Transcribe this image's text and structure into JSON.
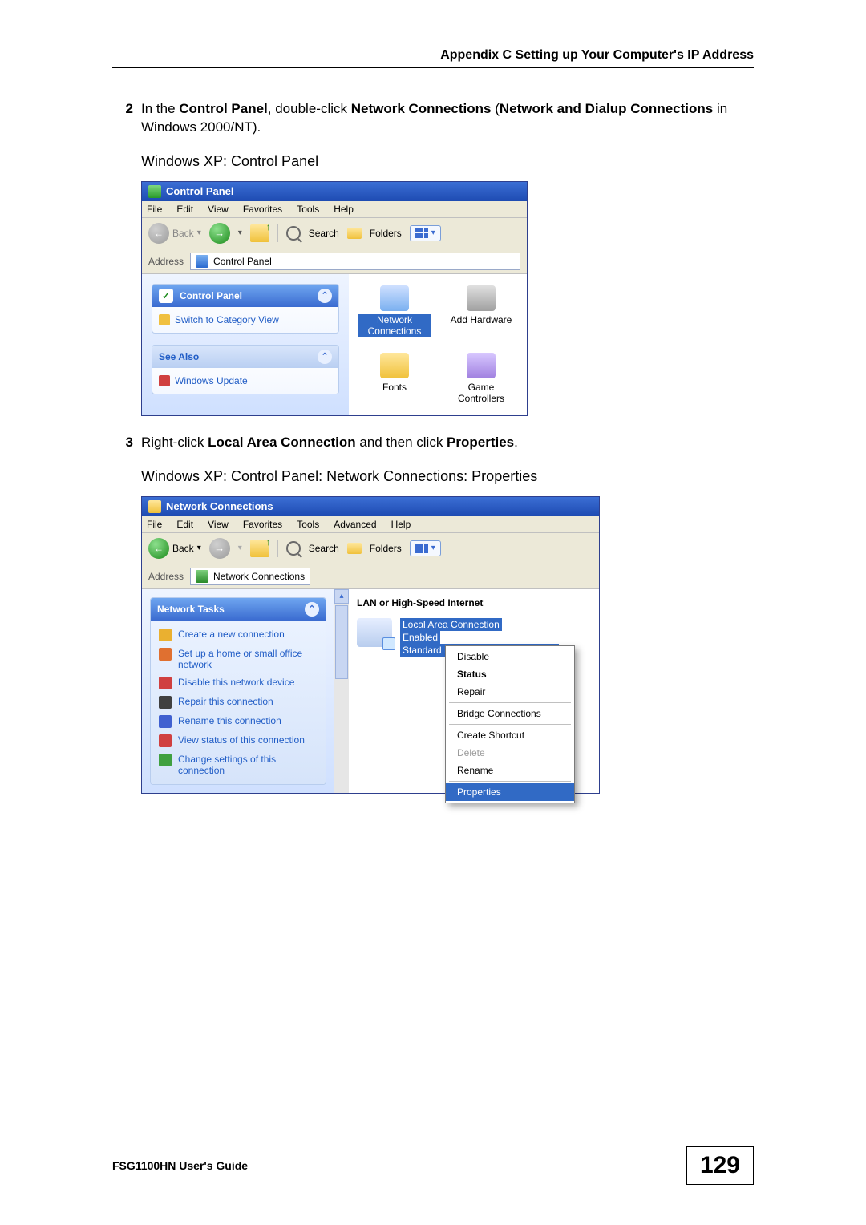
{
  "header": "Appendix C Setting up Your Computer's IP Address",
  "step2": {
    "num": "2",
    "prefix": "In the ",
    "cp": "Control Panel",
    "mid1": ", double-click ",
    "nc": "Network Connections",
    "mid2": " (",
    "ndc": "Network and Dialup Connections",
    "suffix": " in Windows 2000/NT)."
  },
  "caption1": "Windows XP: Control Panel",
  "fig1": {
    "title": "Control Panel",
    "menus": [
      "File",
      "Edit",
      "View",
      "Favorites",
      "Tools",
      "Help"
    ],
    "back": "Back",
    "search": "Search",
    "folders": "Folders",
    "address_label": "Address",
    "address_value": "Control Panel",
    "side_main_title": "Control Panel",
    "side_main_link": "Switch to Category View",
    "side_also_title": "See Also",
    "side_also_link": "Windows Update",
    "items": [
      {
        "label": "Network Connections",
        "selected": true
      },
      {
        "label": "Add Hardware",
        "selected": false
      },
      {
        "label": "Fonts",
        "selected": false
      },
      {
        "label": "Game Controllers",
        "selected": false
      }
    ]
  },
  "step3": {
    "num": "3",
    "prefix": "Right-click ",
    "lac": "Local Area Connection",
    "mid": " and then click ",
    "prop": "Properties",
    "suffix": "."
  },
  "caption2": "Windows XP: Control Panel: Network Connections: Properties",
  "fig2": {
    "title": "Network Connections",
    "menus": [
      "File",
      "Edit",
      "View",
      "Favorites",
      "Tools",
      "Advanced",
      "Help"
    ],
    "back": "Back",
    "search": "Search",
    "folders": "Folders",
    "address_label": "Address",
    "address_value": "Network Connections",
    "side_title": "Network Tasks",
    "tasks": [
      "Create a new connection",
      "Set up a home or small office network",
      "Disable this network device",
      "Repair this connection",
      "Rename this connection",
      "View status of this connection",
      "Change settings of this connection"
    ],
    "section": "LAN or High-Speed Internet",
    "conn_name": "Local Area Connection",
    "conn_status": "Enabled",
    "conn_adapter": "Standard PCI Fast Ethernet Adapter",
    "ctx": [
      "Disable",
      "Status",
      "Repair",
      "Bridge Connections",
      "Create Shortcut",
      "Delete",
      "Rename",
      "Properties"
    ]
  },
  "footer_left": "FSG1100HN User's Guide",
  "page_number": "129"
}
